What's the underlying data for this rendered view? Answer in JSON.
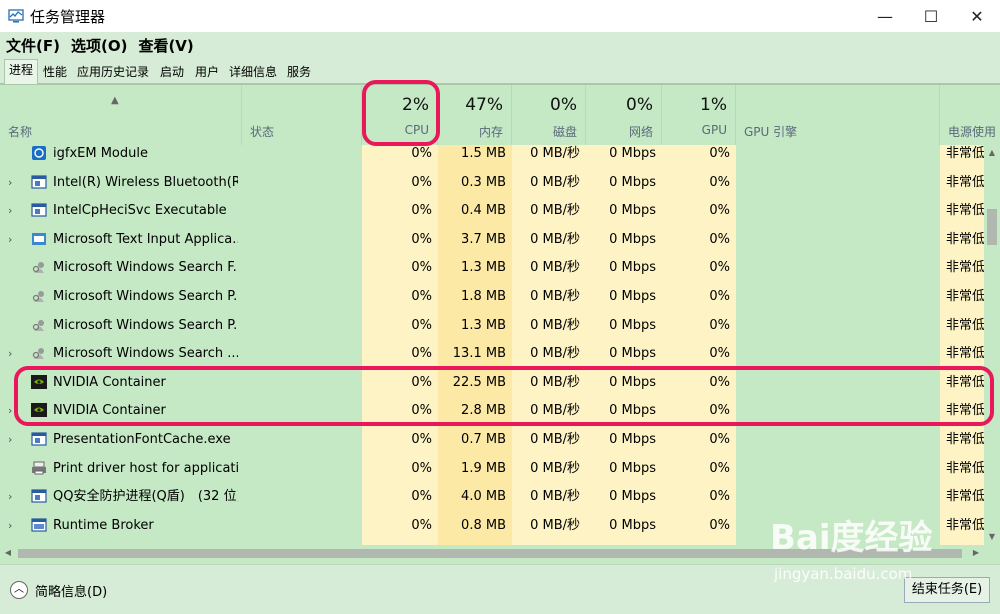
{
  "window": {
    "title": "任务管理器",
    "minimize": "—",
    "maximize": "☐",
    "close": "✕"
  },
  "menu": [
    "文件(F)",
    "选项(O)",
    "查看(V)"
  ],
  "tabs": [
    "进程",
    "性能",
    "应用历史记录",
    "启动",
    "用户",
    "详细信息",
    "服务"
  ],
  "header": {
    "name": "名称",
    "status": "状态",
    "cpu_pct": "2%",
    "cpu": "CPU",
    "mem_pct": "47%",
    "mem": "内存",
    "disk_pct": "0%",
    "disk": "磁盘",
    "net_pct": "0%",
    "net": "网络",
    "gpu_pct": "1%",
    "gpu": "GPU",
    "gpu_engine": "GPU 引擎",
    "power": "电源使用"
  },
  "rows": [
    {
      "name": "igfxEM Module",
      "expand": false,
      "icon": "intel-app-icon",
      "cpu": "0%",
      "mem": "1.5 MB",
      "disk": "0 MB/秒",
      "net": "0 Mbps",
      "gpu": "0%",
      "power": "非常低"
    },
    {
      "name": "Intel(R) Wireless Bluetooth(R...",
      "expand": true,
      "icon": "window-icon",
      "cpu": "0%",
      "mem": "0.3 MB",
      "disk": "0 MB/秒",
      "net": "0 Mbps",
      "gpu": "0%",
      "power": "非常低"
    },
    {
      "name": "IntelCpHeciSvc Executable",
      "expand": true,
      "icon": "window-icon",
      "cpu": "0%",
      "mem": "0.4 MB",
      "disk": "0 MB/秒",
      "net": "0 Mbps",
      "gpu": "0%",
      "power": "非常低"
    },
    {
      "name": "Microsoft Text Input Applica...",
      "expand": true,
      "icon": "text-input-icon",
      "cpu": "0%",
      "mem": "3.7 MB",
      "disk": "0 MB/秒",
      "net": "0 Mbps",
      "gpu": "0%",
      "power": "非常低"
    },
    {
      "name": "Microsoft Windows Search F...",
      "expand": false,
      "icon": "search-person-icon",
      "cpu": "0%",
      "mem": "1.3 MB",
      "disk": "0 MB/秒",
      "net": "0 Mbps",
      "gpu": "0%",
      "power": "非常低"
    },
    {
      "name": "Microsoft Windows Search P...",
      "expand": false,
      "icon": "search-person-icon",
      "cpu": "0%",
      "mem": "1.8 MB",
      "disk": "0 MB/秒",
      "net": "0 Mbps",
      "gpu": "0%",
      "power": "非常低"
    },
    {
      "name": "Microsoft Windows Search P...",
      "expand": false,
      "icon": "search-person-icon",
      "cpu": "0%",
      "mem": "1.3 MB",
      "disk": "0 MB/秒",
      "net": "0 Mbps",
      "gpu": "0%",
      "power": "非常低"
    },
    {
      "name": "Microsoft Windows Search ...",
      "expand": true,
      "icon": "search-person-icon",
      "cpu": "0%",
      "mem": "13.1 MB",
      "disk": "0 MB/秒",
      "net": "0 Mbps",
      "gpu": "0%",
      "power": "非常低"
    },
    {
      "name": "NVIDIA Container",
      "expand": false,
      "icon": "nvidia-icon",
      "cpu": "0%",
      "mem": "22.5 MB",
      "disk": "0 MB/秒",
      "net": "0 Mbps",
      "gpu": "0%",
      "power": "非常低"
    },
    {
      "name": "NVIDIA Container",
      "expand": true,
      "icon": "nvidia-icon",
      "cpu": "0%",
      "mem": "2.8 MB",
      "disk": "0 MB/秒",
      "net": "0 Mbps",
      "gpu": "0%",
      "power": "非常低"
    },
    {
      "name": "PresentationFontCache.exe",
      "expand": true,
      "icon": "window-icon",
      "cpu": "0%",
      "mem": "0.7 MB",
      "disk": "0 MB/秒",
      "net": "0 Mbps",
      "gpu": "0%",
      "power": "非常低"
    },
    {
      "name": "Print driver host for applicati...",
      "expand": false,
      "icon": "printer-icon",
      "cpu": "0%",
      "mem": "1.9 MB",
      "disk": "0 MB/秒",
      "net": "0 Mbps",
      "gpu": "0%",
      "power": "非常低"
    },
    {
      "name": "QQ安全防护进程(Q盾)　(32 位)",
      "expand": true,
      "icon": "window-icon",
      "cpu": "0%",
      "mem": "4.0 MB",
      "disk": "0 MB/秒",
      "net": "0 Mbps",
      "gpu": "0%",
      "power": "非常低"
    },
    {
      "name": "Runtime Broker",
      "expand": true,
      "icon": "broker-icon",
      "cpu": "0%",
      "mem": "0.8 MB",
      "disk": "0 MB/秒",
      "net": "0 Mbps",
      "gpu": "0%",
      "power": "非常低"
    }
  ],
  "footer": {
    "fewer_details": "简略信息(D)",
    "end_task": "结束任务(E)"
  },
  "watermark": {
    "main": "Bai度经验",
    "sub": "jingyan.baidu.com"
  },
  "colors": {
    "highlight": "#e8185a",
    "cpu_col": "#fdf3c4",
    "mem_col": "#fce9a6"
  }
}
